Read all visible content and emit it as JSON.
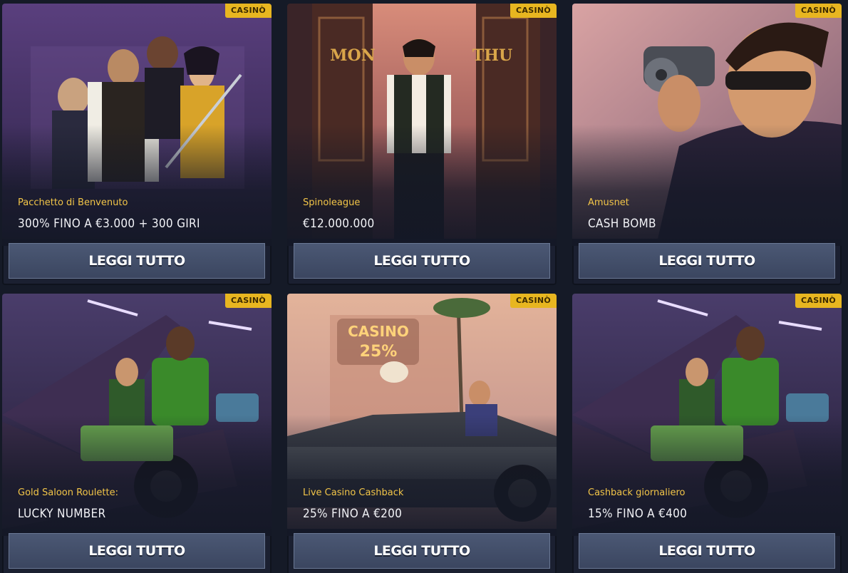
{
  "promotions": [
    {
      "badge": "CASINÒ",
      "provider": "Pacchetto di Benvenuto",
      "offer": "300% FINO A €3.000 + 300 GIRI",
      "button_label": "LEGGI TUTTO",
      "art": "gangster-crew-illustration"
    },
    {
      "badge": "CASINÒ",
      "provider": "Spinoleague",
      "offer": "€12.000.000",
      "button_label": "LEGGI TUTTO",
      "art": "casino-doors-mon-thu-illustration",
      "door_left_text": "MON",
      "door_right_text": "THU"
    },
    {
      "badge": "CASINÒ",
      "provider": "Amusnet",
      "offer": "CASH BOMB",
      "button_label": "LEGGI TUTTO",
      "art": "man-with-revolver-illustration"
    },
    {
      "badge": "CASINÒ",
      "provider": "Gold Saloon Roulette:",
      "offer": "LUCKY NUMBER",
      "button_label": "LEGGI TUTTO",
      "art": "car-trunk-money-illustration"
    },
    {
      "badge": "CASINÒ",
      "provider": "Live Casino Cashback",
      "offer": "25% FINO A €200",
      "button_label": "LEGGI TUTTO",
      "art": "convertible-casino-sign-illustration",
      "sign_text_top": "CASINO",
      "sign_text_bottom": "25%"
    },
    {
      "badge": "CASINÒ",
      "provider": "Cashback giornaliero",
      "offer": "15% FINO A €400",
      "button_label": "LEGGI TUTTO",
      "art": "car-trunk-money-illustration"
    }
  ]
}
